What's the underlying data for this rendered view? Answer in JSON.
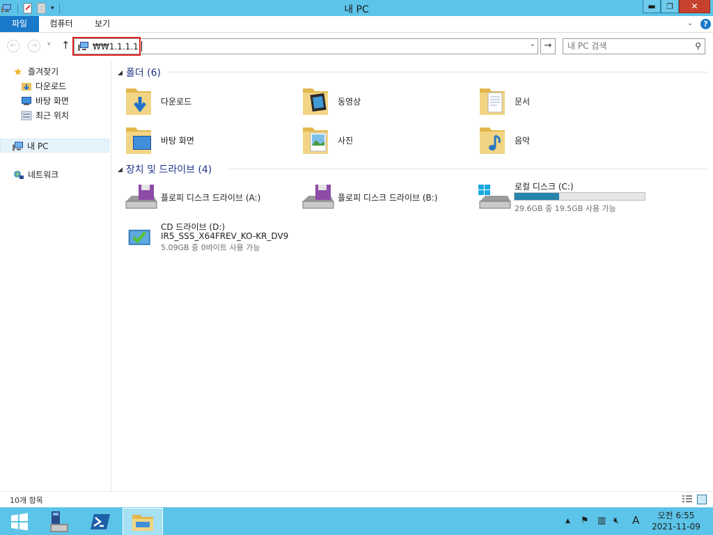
{
  "window": {
    "title": "내 PC"
  },
  "ribbon": {
    "tabs": [
      "파일",
      "컴퓨터",
      "보기"
    ]
  },
  "address": {
    "value": "₩₩1.1.1.1",
    "search_placeholder": "내 PC 검색"
  },
  "sidebar": {
    "favorites": "즐겨찾기",
    "favorites_items": [
      "다운로드",
      "바탕 화면",
      "최근 위치"
    ],
    "this_pc": "내 PC",
    "network": "네트워크"
  },
  "folders": {
    "header": "폴더 (6)",
    "items": [
      "다운로드",
      "동영상",
      "문서",
      "바탕 화면",
      "사진",
      "음악"
    ]
  },
  "devices": {
    "header": "장치 및 드라이브 (4)",
    "floppy_a": "플로피 디스크 드라이브 (A:)",
    "floppy_b": "플로피 디스크 드라이브 (B:)",
    "local_disk": {
      "label": "로컬 디스크 (C:)",
      "space": "29.6GB 중 19.5GB 사용 가능",
      "used_fraction": 0.34
    },
    "cd_drive": {
      "label": "CD 드라이브 (D:)",
      "volume": "IR5_SSS_X64FREV_KO-KR_DV9",
      "space": "5.09GB 중 0바이트 사용 가능"
    }
  },
  "status": {
    "item_count": "10개 항목"
  },
  "taskbar": {
    "clock_time": "오전 6:55",
    "clock_date": "2021-11-09",
    "ime": "A"
  },
  "colors": {
    "accent": "#5cc4e8",
    "file_tab": "#1979ca",
    "close": "#c7422e",
    "highlight": "#e12020"
  }
}
